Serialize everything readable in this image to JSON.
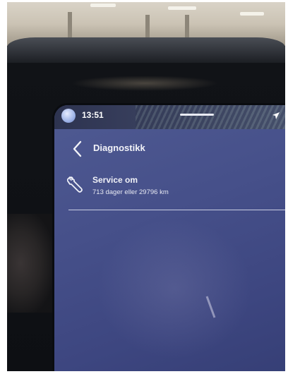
{
  "status_bar": {
    "time": "13:51",
    "profile_icon": "avatar-icon",
    "handle_icon": "drag-handle",
    "navigation_icon": "navigation-arrow-icon"
  },
  "header": {
    "back_icon": "chevron-left-icon",
    "title": "Diagnostikk"
  },
  "service": {
    "icon": "wrench-icon",
    "title": "Service om",
    "detail": "713 dager eller 29796 km"
  },
  "colors": {
    "screen_bg": "#46508a",
    "text": "#f0f1f7",
    "divider": "#c9cde2"
  }
}
